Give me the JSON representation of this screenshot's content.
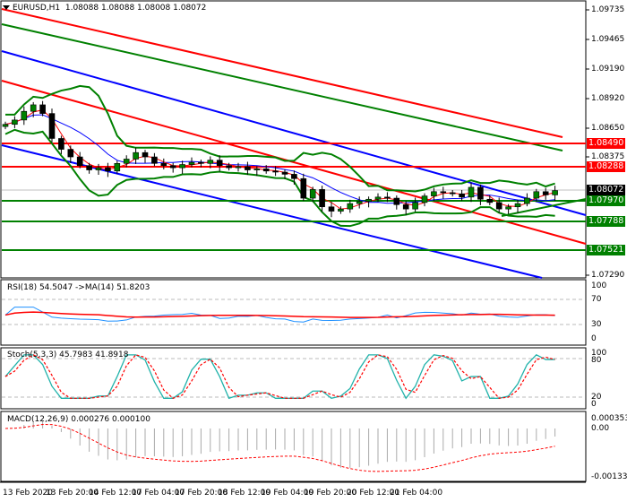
{
  "header": {
    "symbol": "EURUSD,H1",
    "open": "1.08088",
    "high": "1.08088",
    "low": "1.08008",
    "close": "1.08072"
  },
  "price_axis": [
    "1.09735",
    "1.09465",
    "1.09190",
    "1.08920",
    "1.08650",
    "1.08375",
    "1.07290"
  ],
  "price_tags": [
    {
      "value": "1.08490",
      "color": "#ff0000"
    },
    {
      "value": "1.08288",
      "color": "#ff0000"
    },
    {
      "value": "1.08072",
      "color": "#000000"
    },
    {
      "value": "1.07970",
      "color": "#008000"
    },
    {
      "value": "1.07788",
      "color": "#008000"
    },
    {
      "value": "1.07521",
      "color": "#008000"
    }
  ],
  "rsi": {
    "title": "RSI(18) 54.5047  ->MA(14) 51.8203",
    "levels": [
      "100",
      "70",
      "30",
      "0"
    ]
  },
  "stoch": {
    "title": "Stoch(5,3,3) 45.7983 41.8918",
    "levels": [
      "100",
      "80",
      "20",
      "0"
    ]
  },
  "macd": {
    "title": "MACD(12,26,9) 0.000276 0.000100",
    "levels": [
      "0.000353",
      "0.00",
      "-0.001333"
    ]
  },
  "time_axis": [
    "13 Feb 2020",
    "13 Feb 20:00",
    "14 Feb 12:00",
    "17 Feb 04:00",
    "17 Feb 20:00",
    "18 Feb 12:00",
    "19 Feb 04:00",
    "19 Feb 20:00",
    "20 Feb 12:00",
    "21 Feb 04:00"
  ],
  "colors": {
    "bull": "#008000",
    "bear": "#000000",
    "rsi": "#1e90ff",
    "signal": "#ff0000",
    "stoch": "#20b2aa"
  },
  "chart_data": {
    "type": "candlestick",
    "symbol": "EURUSD",
    "timeframe": "H1",
    "closes": [
      1.0868,
      1.0872,
      1.088,
      1.0886,
      1.0878,
      1.0855,
      1.0845,
      1.0838,
      1.083,
      1.0826,
      1.0828,
      1.0825,
      1.0832,
      1.0836,
      1.0842,
      1.0838,
      1.0832,
      1.083,
      1.0828,
      1.0831,
      1.0833,
      1.0832,
      1.0835,
      1.083,
      1.0828,
      1.0829,
      1.0826,
      1.0827,
      1.0825,
      1.0824,
      1.0822,
      1.0818,
      1.08,
      1.0808,
      1.0792,
      1.0788,
      1.079,
      1.0795,
      1.0797,
      1.0799,
      1.0801,
      1.08,
      1.0794,
      1.079,
      1.0796,
      1.0802,
      1.0806,
      1.0805,
      1.0804,
      1.0801,
      1.081,
      1.0799,
      1.0796,
      1.079,
      1.0792,
      1.0795,
      1.08,
      1.0806,
      1.0803,
      1.0807
    ],
    "ylim": [
      1.0729,
      1.09735
    ],
    "horizontal_levels": [
      1.0849,
      1.08288,
      1.0797,
      1.07788,
      1.07521
    ]
  }
}
